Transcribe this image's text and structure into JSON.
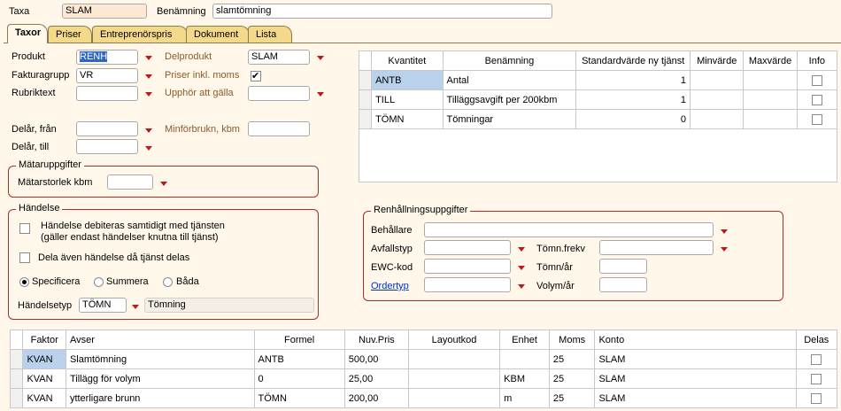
{
  "header": {
    "taxa_label": "Taxa",
    "taxa_value": "SLAM",
    "benamning_label": "Benämning",
    "benamning_value": "slamtömning"
  },
  "tabs": [
    {
      "label": "Taxor",
      "active": true
    },
    {
      "label": "Priser"
    },
    {
      "label": "Entreprenörspris"
    },
    {
      "label": "Dokument"
    },
    {
      "label": "Lista"
    }
  ],
  "form": {
    "produkt_label": "Produkt",
    "produkt_value": "RENH",
    "fakturagrupp_label": "Fakturagrupp",
    "fakturagrupp_value": "VR",
    "rubriktext_label": "Rubriktext",
    "rubriktext_value": "",
    "delprodukt_label": "Delprodukt",
    "delprodukt_value": "SLAM",
    "priser_inkl_moms_label": "Priser inkl. moms",
    "priser_inkl_moms_checked": true,
    "upphor_label": "Upphör att gälla",
    "delar_fran_label": "Delår, från",
    "delar_till_label": "Delår, till",
    "minforbrukn_label": "Minförbrukn, kbm"
  },
  "matar": {
    "title": "Mätaruppgifter",
    "storlek_label": "Mätarstorlek kbm"
  },
  "handelse": {
    "title": "Händelse",
    "debiteras_line1": "Händelse debiteras samtidigt med tjänsten",
    "debiteras_line2": "(gäller endast händelser knutna till tjänst)",
    "dela_label": "Dela även händelse då tjänst delas",
    "radio_specificera": "Specificera",
    "radio_summera": "Summera",
    "radio_bada": "Båda",
    "setyp_label": "Händelsetyp",
    "setyp_value": "TÖMN",
    "setyp_desc": "Tömning"
  },
  "renhallning": {
    "title": "Renhållningsuppgifter",
    "behallare_label": "Behållare",
    "avfallstyp_label": "Avfallstyp",
    "ewc_label": "EWC-kod",
    "ordertyp_label": "Ordertyp",
    "tomn_frekv_label": "Tömn.frekv",
    "tomn_ar_label": "Tömn/år",
    "volym_ar_label": "Volym/år"
  },
  "kvantitet_table": {
    "headers": [
      "Kvantitet",
      "Benämning",
      "Standardvärde ny tjänst",
      "Minvärde",
      "Maxvärde",
      "Info"
    ],
    "rows": [
      {
        "kvantitet": "ANTB",
        "benamning": "Antal",
        "standard": "1",
        "min": "",
        "max": ""
      },
      {
        "kvantitet": "TILL",
        "benamning": "Tilläggsavgift per 200kbm",
        "standard": "1",
        "min": "",
        "max": ""
      },
      {
        "kvantitet": "TÖMN",
        "benamning": "Tömningar",
        "standard": "0",
        "min": "",
        "max": ""
      }
    ]
  },
  "faktor_table": {
    "headers": [
      "Faktor",
      "Avser",
      "Formel",
      "Nuv.Pris",
      "Layoutkod",
      "Enhet",
      "Moms",
      "Konto",
      "Delas"
    ],
    "rows": [
      {
        "faktor": "KVAN",
        "avser": "Slamtömning",
        "formel": "ANTB",
        "pris": "500,00",
        "layout": "",
        "enhet": "",
        "moms": "25",
        "konto": "SLAM"
      },
      {
        "faktor": "KVAN",
        "avser": "Tillägg för volym",
        "formel": "0",
        "pris": "25,00",
        "layout": "",
        "enhet": "KBM",
        "moms": "25",
        "konto": "SLAM"
      },
      {
        "faktor": "KVAN",
        "avser": "ytterligare brunn",
        "formel": "TÖMN",
        "pris": "200,00",
        "layout": "",
        "enhet": "m",
        "moms": "25",
        "konto": "SLAM"
      }
    ]
  },
  "colors": {
    "background": "#fff7e9",
    "tab": "#f5d98a",
    "group_border": "#a0302a",
    "dropdown_arrow": "#c0181a",
    "selection": "#b9d1ea"
  }
}
